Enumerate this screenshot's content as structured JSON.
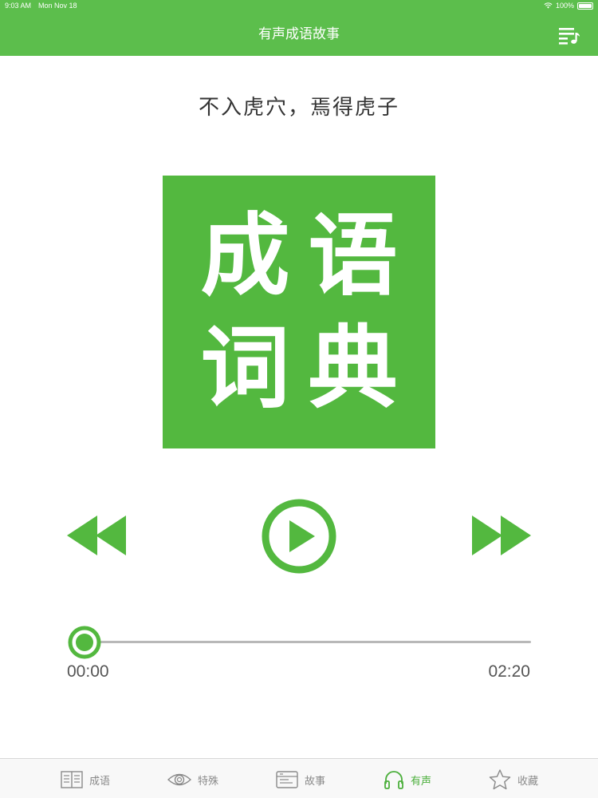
{
  "status_bar": {
    "time": "9:03 AM",
    "date": "Mon Nov 18",
    "battery": "100%"
  },
  "header": {
    "title": "有声成语故事",
    "playlist_icon": "playlist-music-icon"
  },
  "player": {
    "track_title": "不入虎穴，焉得虎子",
    "cover_text": [
      "成",
      "语",
      "词",
      "典"
    ],
    "controls": {
      "rewind_icon": "rewind-icon",
      "play_icon": "play-circle-icon",
      "forward_icon": "fast-forward-icon"
    },
    "progress": 0,
    "current_time": "00:00",
    "total_time": "02:20"
  },
  "tabs": [
    {
      "label": "成语",
      "icon": "book-icon",
      "active": false
    },
    {
      "label": "特殊",
      "icon": "eye-icon",
      "active": false
    },
    {
      "label": "故事",
      "icon": "story-list-icon",
      "active": false
    },
    {
      "label": "有声",
      "icon": "headphones-icon",
      "active": true
    },
    {
      "label": "收藏",
      "icon": "star-icon",
      "active": false
    }
  ],
  "colors": {
    "accent": "#5cbe4c",
    "cover": "#53b83f",
    "tab_inactive": "#8a8a8a"
  }
}
